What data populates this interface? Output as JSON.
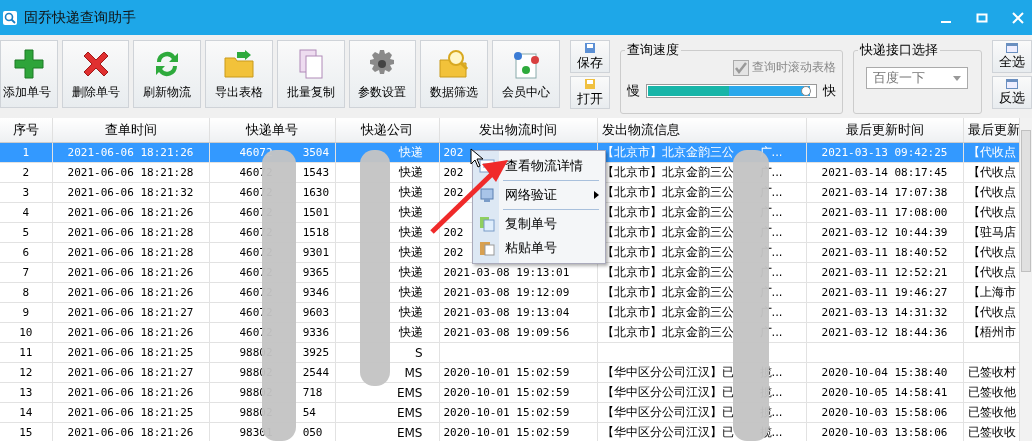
{
  "window": {
    "title": "固乔快递查询助手"
  },
  "toolbar": [
    {
      "label": "添加单号"
    },
    {
      "label": "删除单号"
    },
    {
      "label": "刷新物流"
    },
    {
      "label": "导出表格"
    },
    {
      "label": "批量复制"
    },
    {
      "label": "参数设置"
    },
    {
      "label": "数据筛选"
    },
    {
      "label": "会员中心"
    }
  ],
  "file_buttons": [
    {
      "label": "保存"
    },
    {
      "label": "打开"
    }
  ],
  "speed_group": {
    "title": "查询速度",
    "checkbox": {
      "label": "查询时滚动表格",
      "checked": true,
      "disabled": true
    },
    "slow_label": "慢",
    "fast_label": "快",
    "slider": {
      "level": 0.97
    }
  },
  "api_group": {
    "title": "快递接口选择",
    "dropdown": {
      "value": "百度一下"
    }
  },
  "select_buttons": [
    {
      "label": "全选"
    },
    {
      "label": "反选"
    }
  ],
  "table": {
    "columns": [
      "序号",
      "查单时间",
      "快递单号",
      "快递公司",
      "发出物流时间",
      "发出物流信息",
      "最后更新时间",
      "最后更新"
    ],
    "rows": [
      {
        "selected": true,
        "no": "1",
        "query_time": "2021-06-06 18:21:26",
        "number_start": "46072",
        "number_end": "3504",
        "company": "快递",
        "send_time": "202",
        "info_start": "【北京市】北京金韵三公",
        "info_end": "广...",
        "update_time": "2021-03-13 09:42:25",
        "update": "【代收点"
      },
      {
        "selected": false,
        "no": "2",
        "query_time": "2021-06-06 18:21:28",
        "number_start": "46072",
        "number_end": "1543",
        "company": "快递",
        "send_time": "202",
        "info_start": "【北京市】北京金韵三公",
        "info_end": "广...",
        "update_time": "2021-03-14 08:17:45",
        "update": "【代收点"
      },
      {
        "selected": false,
        "no": "3",
        "query_time": "2021-06-06 18:21:32",
        "number_start": "46072",
        "number_end": "1630",
        "company": "快递",
        "send_time": "202",
        "info_start": "【北京市】北京金韵三公",
        "info_end": "广...",
        "update_time": "2021-03-14 17:07:38",
        "update": "【代收点"
      },
      {
        "selected": false,
        "no": "4",
        "query_time": "2021-06-06 18:21:26",
        "number_start": "46072",
        "number_end": "1501",
        "company": "快递",
        "info_start": "【北京市】北京金韵三公",
        "info_end": "广...",
        "update_time": "2021-03-11 17:08:00",
        "update": "【代收点"
      },
      {
        "selected": false,
        "no": "5",
        "query_time": "2021-06-06 18:21:28",
        "number_start": "46072",
        "number_end": "1518",
        "company": "快递",
        "send_time": "202",
        "info_start": "【北京市】北京金韵三公",
        "info_end": "广...",
        "update_time": "2021-03-12 10:44:39",
        "update": "【驻马店"
      },
      {
        "selected": false,
        "no": "6",
        "query_time": "2021-06-06 18:21:28",
        "number_start": "46072",
        "number_end": "9301",
        "company": "快递",
        "send_time": "202",
        "info_start": "【北京市】北京金韵三公",
        "info_end": "广...",
        "update_time": "2021-03-11 18:40:52",
        "update": "【代收点"
      },
      {
        "selected": false,
        "no": "7",
        "query_time": "2021-06-06 18:21:26",
        "number_start": "46072",
        "number_end": "9365",
        "company": "快递",
        "send_time": "2021-03-08 19:13:01",
        "info_start": "【北京市】北京金韵三公",
        "info_end": "广...",
        "update_time": "2021-03-11 12:52:21",
        "update": "【代收点"
      },
      {
        "selected": false,
        "no": "8",
        "query_time": "2021-06-06 18:21:26",
        "number_start": "46072",
        "number_end": "9346",
        "company": "快递",
        "send_time": "2021-03-08 19:12:09",
        "info_start": "【北京市】北京金韵三公",
        "info_end": "广...",
        "update_time": "2021-03-11 19:46:27",
        "update": "【上海市"
      },
      {
        "selected": false,
        "no": "9",
        "query_time": "2021-06-06 18:21:27",
        "number_start": "46072",
        "number_end": "9603",
        "company": "快递",
        "send_time": "2021-03-08 19:13:04",
        "info_start": "【北京市】北京金韵三公",
        "info_end": "广...",
        "update_time": "2021-03-13 14:31:32",
        "update": "【代收点"
      },
      {
        "selected": false,
        "no": "10",
        "query_time": "2021-06-06 18:21:26",
        "number_start": "46072",
        "number_end": "9336",
        "company": "快递",
        "send_time": "2021-03-08 19:09:56",
        "info_start": "【北京市】北京金韵三公",
        "info_end": "广...",
        "update_time": "2021-03-12 18:44:36",
        "update": "【梧州市"
      },
      {
        "selected": false,
        "no": "11",
        "query_time": "2021-06-06 18:21:25",
        "number_start": "98802",
        "number_end": "3925",
        "company": "S"
      },
      {
        "selected": false,
        "no": "12",
        "query_time": "2021-06-06 18:21:27",
        "number_start": "98802",
        "number_end": "2544",
        "company": "MS",
        "send_time": "2020-10-01 15:02:59",
        "info_start": "【华中区分公司江汉】已",
        "info_end": "揽...",
        "update_time": "2020-10-04 15:38:40",
        "update": "已签收村"
      },
      {
        "selected": false,
        "no": "13",
        "query_time": "2021-06-06 18:21:26",
        "number_start": "98802",
        "number_end": "718",
        "company": "EMS",
        "send_time": "2020-10-01 15:02:59",
        "info_start": "【华中区分公司江汉】已",
        "info_end": "揽...",
        "update_time": "2020-10-05 14:58:41",
        "update": "已签收他"
      },
      {
        "selected": false,
        "no": "14",
        "query_time": "2021-06-06 18:21:25",
        "number_start": "98802",
        "number_end": "54",
        "company": "EMS",
        "send_time": "2020-10-01 15:02:59",
        "info_start": "【华中区分公司江汉】已",
        "info_end": "揽...",
        "update_time": "2020-10-03 15:58:06",
        "update": "已签收他"
      },
      {
        "selected": false,
        "no": "15",
        "query_time": "2021-06-06 18:21:26",
        "number_start": "98301",
        "number_end": "050",
        "company": "EMS",
        "send_time": "2020-10-01 15:02:59",
        "info_start": "【华中区分公司江汉】已",
        "info_end": "揽...",
        "update_time": "2020-10-03 13:58:06",
        "update": "已签收收"
      }
    ]
  },
  "context_menu": {
    "items": [
      {
        "label": "查看物流详情",
        "submenu": false
      },
      {
        "label": "网络验证",
        "submenu": true
      },
      {
        "label": "复制单号",
        "submenu": false
      },
      {
        "label": "粘贴单号",
        "submenu": false
      }
    ]
  }
}
